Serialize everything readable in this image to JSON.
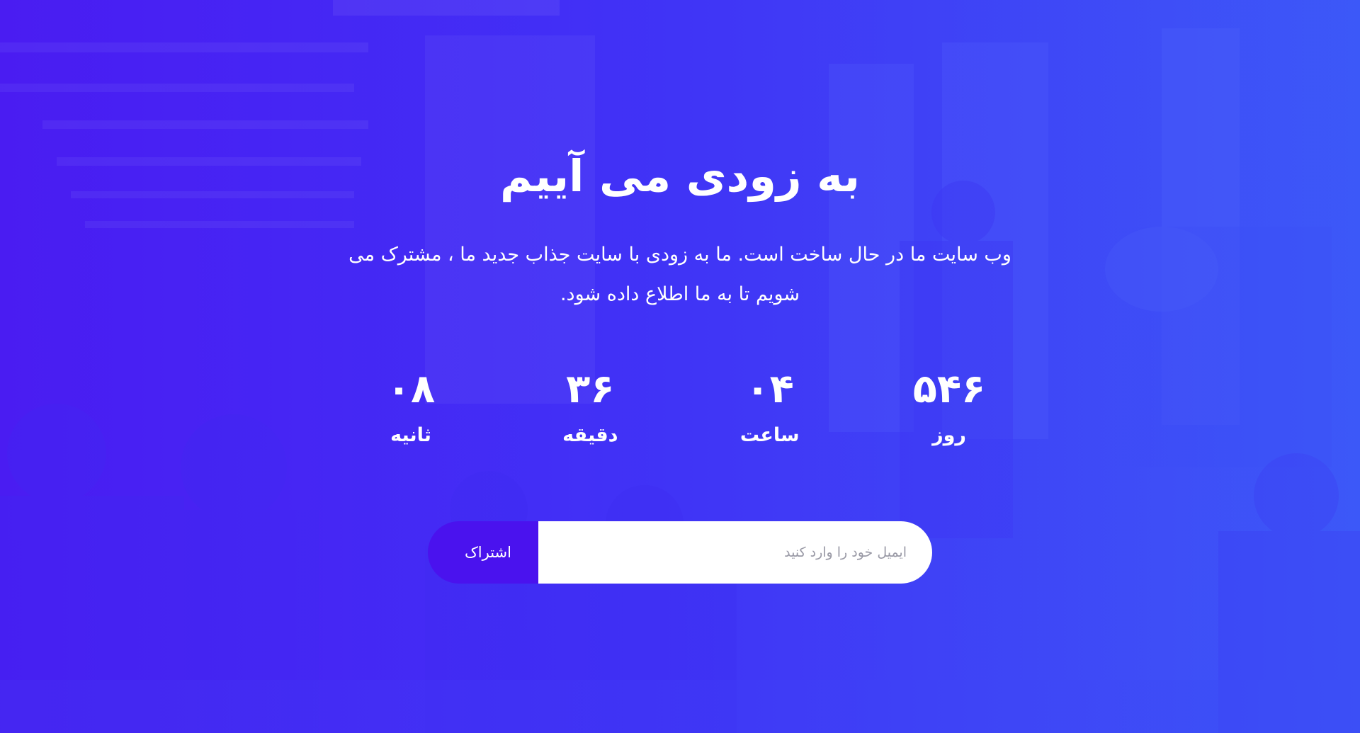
{
  "hero": {
    "title": "به زودی می آییم",
    "subtitle": "وب سایت ما در حال ساخت است. ما به زودی با سایت جذاب جدید ما ، مشترک می شویم تا به ما اطلاع داده شود."
  },
  "countdown": {
    "days": {
      "value": "۵۴۶",
      "label": "روز"
    },
    "hours": {
      "value": "۰۴",
      "label": "ساعت"
    },
    "minutes": {
      "value": "۳۶",
      "label": "دقیقه"
    },
    "seconds": {
      "value": "۰۸",
      "label": "ثانیه"
    }
  },
  "subscribe": {
    "placeholder": "ایمیل خود را وارد کنید",
    "value": "",
    "button_label": "اشتراک"
  },
  "colors": {
    "background": "#3f34f6",
    "button": "#4a12ee",
    "text": "#ffffff"
  }
}
